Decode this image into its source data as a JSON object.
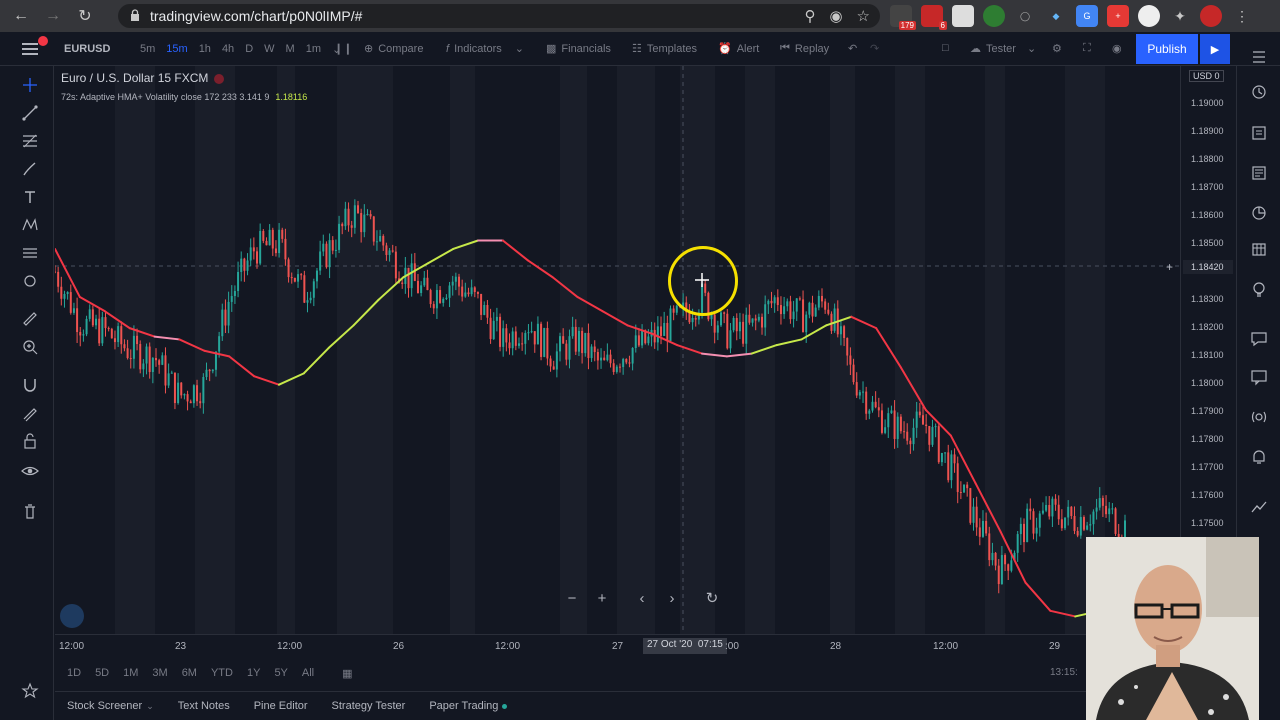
{
  "browser": {
    "url": "tradingview.com/chart/p0N0lIMP/#",
    "ext_badges": [
      "179",
      "6"
    ]
  },
  "toolbar": {
    "symbol": "EURUSD",
    "timeframes": [
      "5m",
      "15m",
      "1h",
      "4h",
      "D",
      "W",
      "M",
      "1m"
    ],
    "active_timeframe": "15m",
    "compare": "Compare",
    "indicators": "Indicators",
    "financials": "Financials",
    "templates": "Templates",
    "alert": "Alert",
    "replay": "Replay",
    "tester": "Tester",
    "publish": "Publish"
  },
  "legend": {
    "title": "Euro / U.S. Dollar  15  FXCM",
    "indicator": "72s: Adaptive HMA+ Volatility close 172 233 3.141 9",
    "indicator_value": "1.18116"
  },
  "price_axis": {
    "currency": "USD",
    "currency_value": "0",
    "levels": [
      "1.19000",
      "1.18900",
      "1.18800",
      "1.18700",
      "1.18600",
      "1.18500",
      "1.18300",
      "1.18200",
      "1.18100",
      "1.18000",
      "1.17900",
      "1.17800",
      "1.17700",
      "1.17600",
      "1.17500"
    ],
    "crosshair_price": "1.18420"
  },
  "time_axis": {
    "labels": [
      "12:00",
      "23",
      "12:00",
      "26",
      "12:00",
      "27",
      "07:15",
      ":00",
      "28",
      "12:00",
      "29"
    ],
    "crosshair_time": "27 Oct '20"
  },
  "ranges": [
    "1D",
    "5D",
    "1M",
    "3M",
    "6M",
    "YTD",
    "1Y",
    "5Y",
    "All"
  ],
  "clock": "13:15:",
  "bottom_tabs": [
    "Stock Screener",
    "Text Notes",
    "Pine Editor",
    "Strategy Tester",
    "Paper Trading"
  ],
  "colors": {
    "bg": "#131722",
    "candle_up": "#26a69a",
    "candle_down": "#ef5350",
    "hma_up": "#c6e84a",
    "hma_down": "#f23645",
    "hma_neutral": "#f48fb1",
    "accent": "#2962ff",
    "cursor_ring": "#f5e000"
  },
  "chart_data": {
    "type": "line",
    "series": [
      {
        "values": [
          1.1848,
          1.1831,
          1.1826,
          1.182,
          1.1817,
          1.1816,
          1.1812,
          1.181,
          1.1803,
          1.18,
          1.1804,
          1.1813,
          1.1821,
          1.183,
          1.1838,
          1.1843,
          1.1848,
          1.1851,
          1.1851,
          1.1844,
          1.1838,
          1.1831,
          1.1826,
          1.1821,
          1.1818,
          1.1814,
          1.1811,
          1.181,
          1.1811,
          1.1814,
          1.1816,
          1.1821,
          1.1824,
          1.182,
          1.1806,
          1.1791,
          1.1782,
          1.1765,
          1.1748,
          1.173,
          1.172,
          1.1718,
          1.172,
          1.1718
        ]
      },
      {
        "values": [
          1.184,
          1.1822,
          1.1819,
          1.1812,
          1.181,
          1.1796,
          1.18,
          1.183,
          1.1848,
          1.185,
          1.1832,
          1.1848,
          1.1861,
          1.1852,
          1.184,
          1.1831,
          1.1837,
          1.1829,
          1.1815,
          1.1822,
          1.181,
          1.1816,
          1.1806,
          1.1812,
          1.1816,
          1.1823,
          1.1831,
          1.1818,
          1.182,
          1.1831,
          1.1824,
          1.183,
          1.1804,
          1.179,
          1.1784,
          1.1786,
          1.177,
          1.1752,
          1.1734,
          1.175,
          1.1755,
          1.1752,
          1.1756,
          1.175
        ]
      }
    ],
    "ylim": [
      1.172,
      1.192
    ]
  }
}
